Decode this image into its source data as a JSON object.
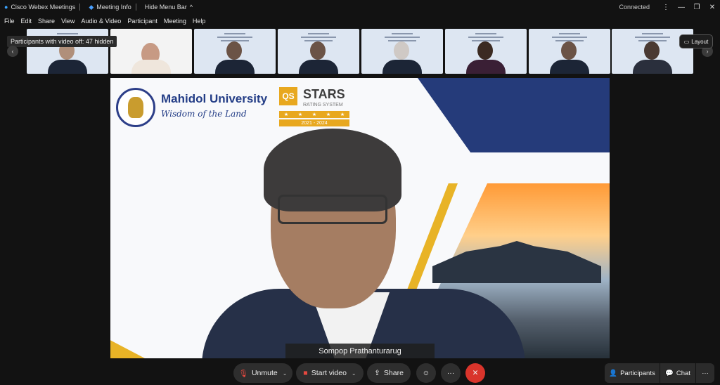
{
  "titlebar": {
    "app_name": "Cisco Webex Meetings",
    "meeting_info": "Meeting Info",
    "hide_menu_bar": "Hide Menu Bar",
    "connection_status": "Connected",
    "app_icon": "webex-icon",
    "info_icon": "shield-icon"
  },
  "menu": [
    "File",
    "Edit",
    "Share",
    "View",
    "Audio & Video",
    "Participant",
    "Meeting",
    "Help"
  ],
  "participant_strip": {
    "tooltip": "Participants with video off: 47 hidden",
    "layout_label": "Layout",
    "tile_count": 8
  },
  "stage": {
    "university_name": "Mahidol University",
    "university_tagline": "Wisdom of the Land",
    "qs_badge": "QS",
    "qs_stars_label": "STARS",
    "qs_rating_text": "RATING SYSTEM",
    "qs_years": "2021 - 2024",
    "speaker_name": "Sompop Prathanturarug"
  },
  "controls": {
    "unmute": "Unmute",
    "start_video": "Start video",
    "share": "Share",
    "participants": "Participants",
    "chat": "Chat"
  },
  "colors": {
    "background": "#121212",
    "end_meeting": "#d9342b",
    "muted_mic": "#e5483f",
    "brand_blue": "#233d86",
    "qs_gold": "#e8a81f"
  }
}
